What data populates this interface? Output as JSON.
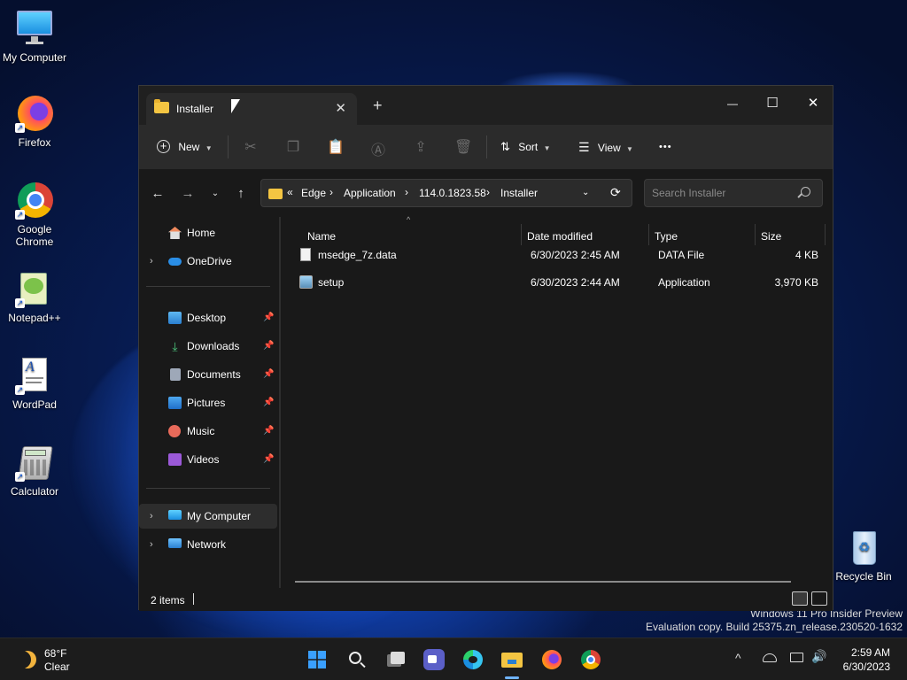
{
  "desktop": {
    "icons": [
      {
        "label": "My Computer",
        "icon": "monitor-icon"
      },
      {
        "label": "Firefox",
        "icon": "firefox-icon"
      },
      {
        "label": "Google Chrome",
        "icon": "chrome-icon"
      },
      {
        "label": "Notepad++",
        "icon": "notepadpp-icon"
      },
      {
        "label": "WordPad",
        "icon": "wordpad-icon"
      },
      {
        "label": "Calculator",
        "icon": "calculator-icon"
      }
    ],
    "recycle_bin": "Recycle Bin",
    "watermark": {
      "line1": "Windows 11 Pro Insider Preview",
      "line2": "Evaluation copy. Build 25375.zn_release.230520-1632"
    }
  },
  "window": {
    "tab_title": "Installer",
    "tab_close": "✕",
    "new_tab": "+",
    "controls": {
      "minimize": "—",
      "maximize": "☐",
      "close": "✕"
    },
    "toolbar": {
      "new_label": "New",
      "sort_label": "Sort",
      "view_label": "View",
      "more_label": "•••"
    },
    "address": {
      "overflow": "«",
      "crumbs": [
        "Edge",
        "Application",
        "114.0.1823.58",
        "Installer"
      ]
    },
    "search": {
      "placeholder": "Search Installer"
    },
    "sidebar": {
      "home": "Home",
      "onedrive": "OneDrive",
      "quick": [
        "Desktop",
        "Downloads",
        "Documents",
        "Pictures",
        "Music",
        "Videos"
      ],
      "mycomputer": "My Computer",
      "network": "Network"
    },
    "columns": {
      "name": "Name",
      "date": "Date modified",
      "type": "Type",
      "size": "Size"
    },
    "files": [
      {
        "name": "msedge_7z.data",
        "date": "6/30/2023 2:45 AM",
        "type": "DATA File",
        "size": "4 KB"
      },
      {
        "name": "setup",
        "date": "6/30/2023 2:44 AM",
        "type": "Application",
        "size": "3,970 KB"
      }
    ],
    "status": "2 items"
  },
  "taskbar": {
    "weather": {
      "temp": "68°F",
      "condition": "Clear"
    },
    "clock": {
      "time": "2:59 AM",
      "date": "6/30/2023"
    }
  }
}
